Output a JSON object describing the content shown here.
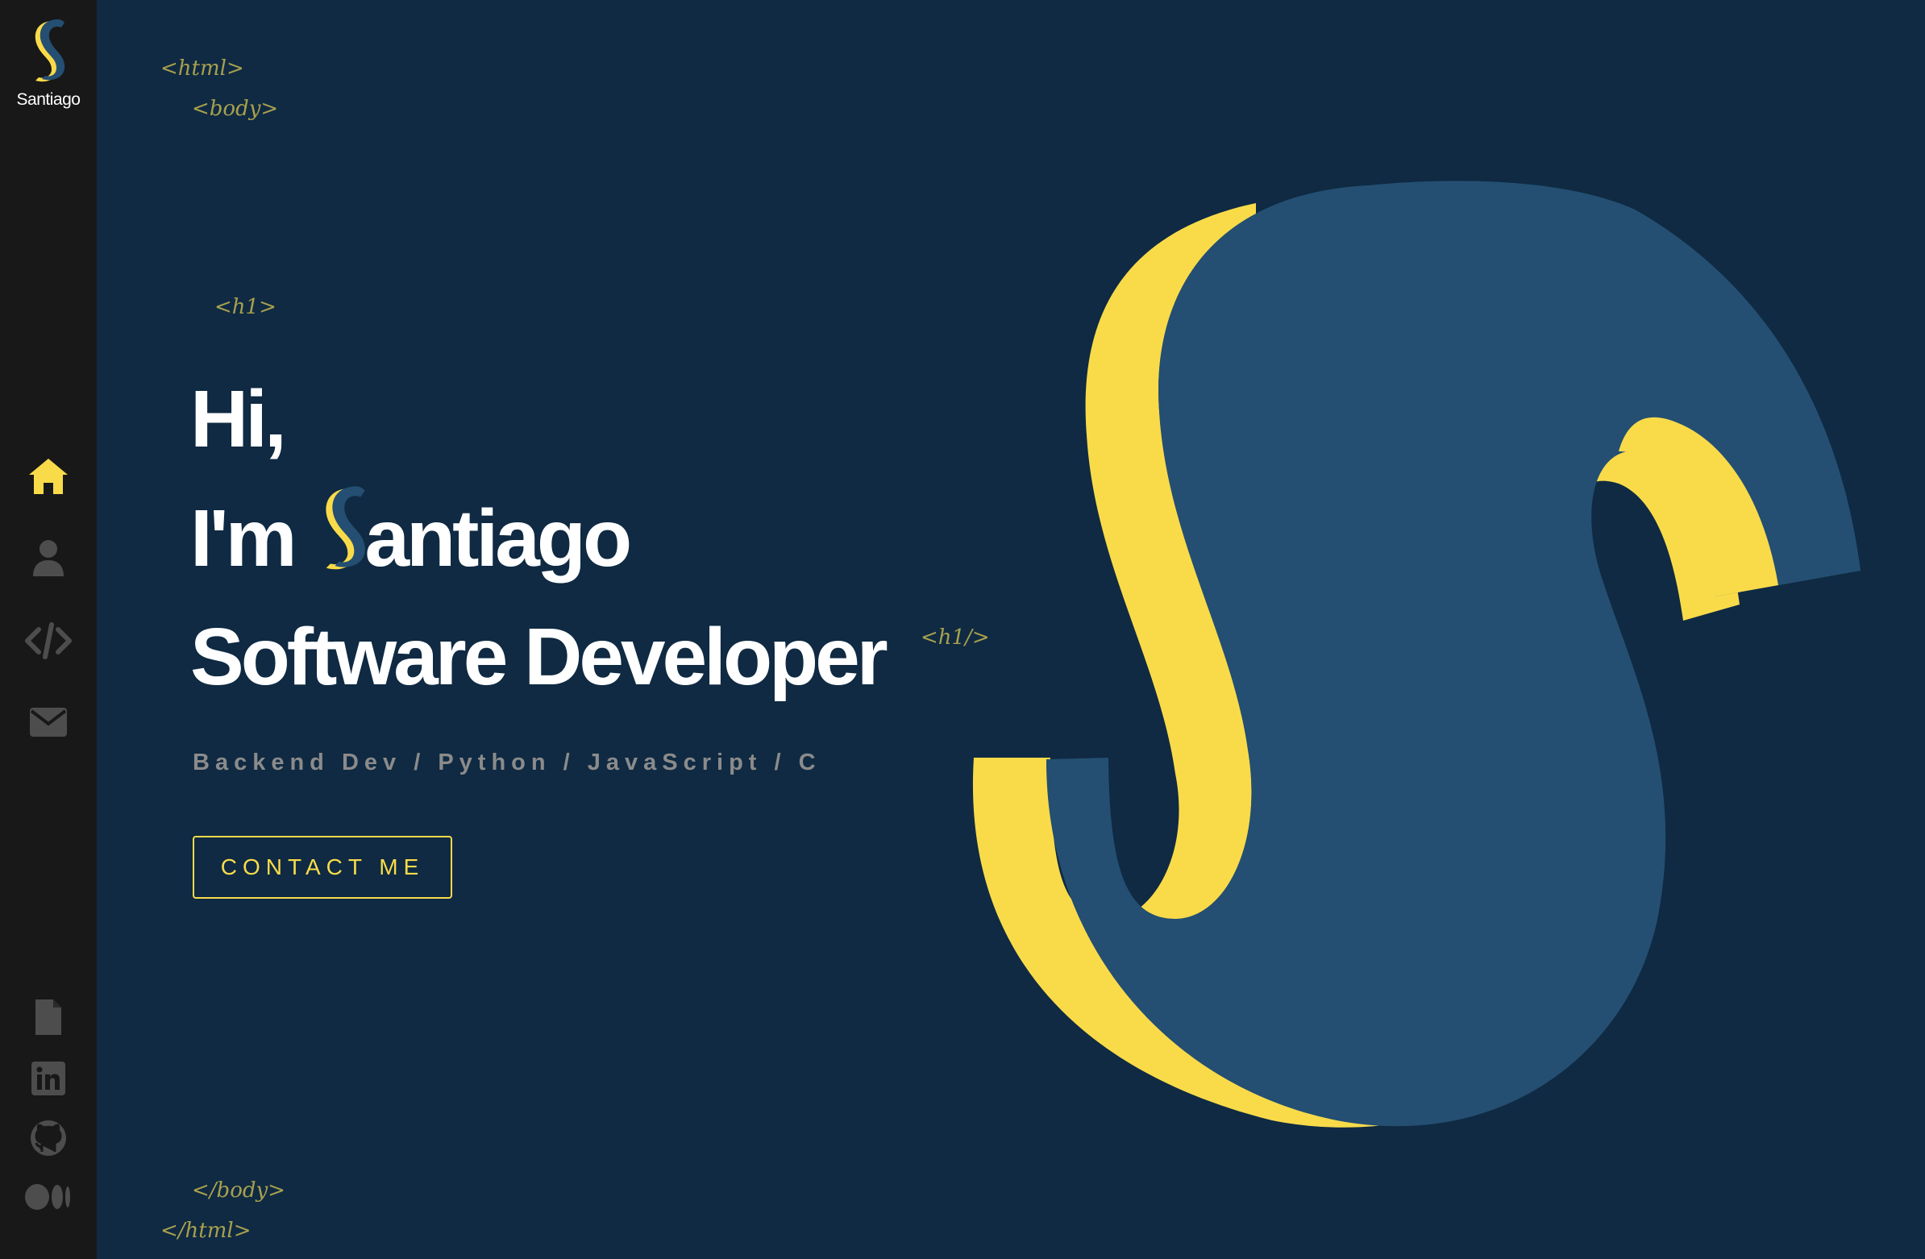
{
  "brand": {
    "name": "Santiago"
  },
  "colors": {
    "sidebar_bg": "#181818",
    "main_bg": "#0f2a42",
    "accent_yellow": "#f9db4a",
    "accent_blue": "#244f72",
    "tag_color": "#a8a04e",
    "icon_gray": "#4d4d4d",
    "active_icon": "#f9db4a"
  },
  "nav": [
    {
      "icon": "home-icon",
      "active": true
    },
    {
      "icon": "user-icon",
      "active": false
    },
    {
      "icon": "code-icon",
      "active": false
    },
    {
      "icon": "envelope-icon",
      "active": false
    }
  ],
  "social": [
    {
      "icon": "file-icon"
    },
    {
      "icon": "linkedin-icon"
    },
    {
      "icon": "github-icon"
    },
    {
      "icon": "medium-icon"
    }
  ],
  "tags": {
    "html_open": "<html>",
    "body_open": "<body>",
    "h1_open": "<h1>",
    "h1_close": "<h1/>",
    "body_close": "</body>",
    "html_close": "</html>"
  },
  "hero": {
    "line1": "Hi,",
    "line2_prefix": "I'm",
    "line2_name_rest": "antiago",
    "line3": "Software Developer"
  },
  "subtitle": "Backend Dev / Python / JavaScript / C",
  "contact_button": "CONTACT ME"
}
